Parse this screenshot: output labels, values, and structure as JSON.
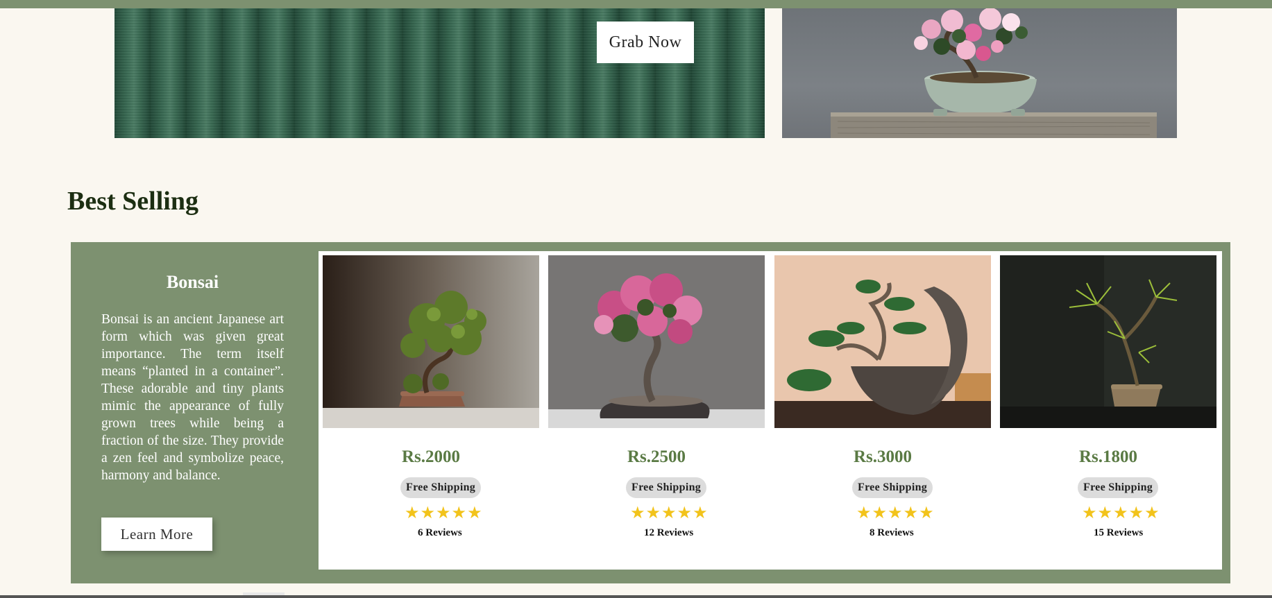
{
  "banner": {
    "grab_label": "Grab Now"
  },
  "section": {
    "title": "Best Selling"
  },
  "info": {
    "title": "Bonsai",
    "description": "Bonsai is an ancient Japanese art form which was given great importance. The term itself means “planted in a container”. These adorable and tiny plants mimic the appearance of fully grown trees while being a fraction of the size. They provide a zen feel and symbolize peace, harmony and balance.",
    "learn_label": "Learn More"
  },
  "products": [
    {
      "price": "Rs.2000",
      "shipping": "Free Shipping",
      "stars": "★★★★★",
      "rating": 5,
      "reviews": "6 Reviews"
    },
    {
      "price": "Rs.2500",
      "shipping": "Free Shipping",
      "stars": "★★★★★",
      "rating": 5,
      "reviews": "12 Reviews"
    },
    {
      "price": "Rs.3000",
      "shipping": "Free Shipping",
      "stars": "★★★★★",
      "rating": 5,
      "reviews": "8 Reviews"
    },
    {
      "price": "Rs.1800",
      "shipping": "Free Shipping",
      "stars": "★★★★★",
      "rating": 5,
      "reviews": "15 Reviews"
    }
  ],
  "colors": {
    "accent_green": "#7d9170",
    "price_green": "#5a7a44",
    "star_yellow": "#f2c31b",
    "background": "#faf7f0"
  }
}
